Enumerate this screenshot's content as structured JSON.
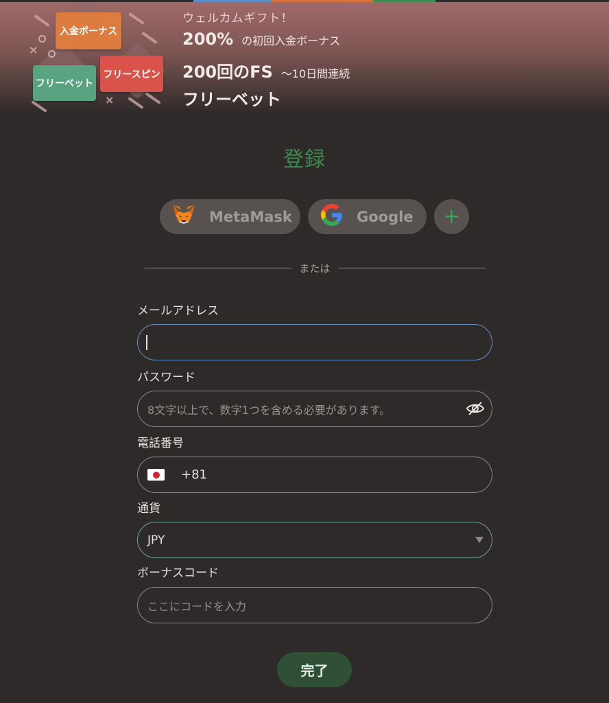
{
  "promo": {
    "tags": {
      "deposit": "入金ボーナス",
      "freespin": "フリースピン",
      "freebet": "フリーベット"
    },
    "subtitle": "ウェルカムギフト！",
    "lines": [
      {
        "big": "200%",
        "small": "の初回入金ボーナス"
      },
      {
        "big": "200回のFS",
        "small": "〜10日間連続"
      },
      {
        "big": "フリーベット",
        "small": ""
      }
    ]
  },
  "title": "登録",
  "social": {
    "metamask": "MetaMask",
    "google": "Google",
    "more": "+"
  },
  "divider_text": "または",
  "form": {
    "email": {
      "label": "メールアドレス",
      "value": ""
    },
    "password": {
      "label": "パスワード",
      "placeholder": "8文字以上で、数字1つを含める必要があります。"
    },
    "phone": {
      "label": "電話番号",
      "dial_code": "+81"
    },
    "currency": {
      "label": "通貨",
      "value": "JPY"
    },
    "bonus": {
      "label": "ボーナスコード",
      "placeholder": "ここにコードを入力"
    }
  },
  "submit_label": "完了",
  "colors": {
    "background": "#2d2a29",
    "title_green": "#3e8a4e",
    "submit_bg": "#2f4f37",
    "focus_border": "#6b93c7"
  }
}
